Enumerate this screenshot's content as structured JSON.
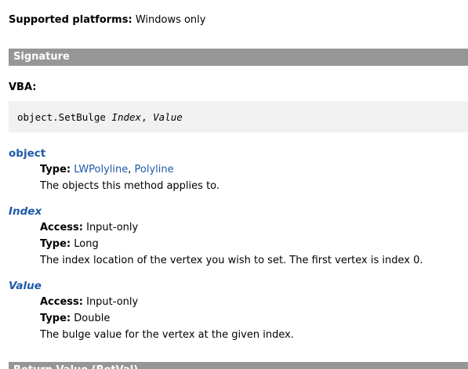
{
  "platforms": {
    "label": "Supported platforms:",
    "value": "Windows only"
  },
  "signature_section": {
    "title": "Signature"
  },
  "vba": {
    "label": "VBA:",
    "code_prefix": "object.SetBulge ",
    "code_arg1": "Index",
    "code_sep": ", ",
    "code_arg2": "Value"
  },
  "params": {
    "object": {
      "name": "object",
      "type_label": "Type:",
      "type_link1": "LWPolyline",
      "type_sep": ", ",
      "type_link2": "Polyline",
      "description": "The objects this method applies to."
    },
    "index": {
      "name": "Index",
      "access_label": "Access:",
      "access_value": "Input-only",
      "type_label": "Type:",
      "type_value": "Long",
      "description": "The index location of the vertex you wish to set. The first vertex is index 0."
    },
    "value": {
      "name": "Value",
      "access_label": "Access:",
      "access_value": "Input-only",
      "type_label": "Type:",
      "type_value": "Double",
      "description": "The bulge value for the vertex at the given index."
    }
  },
  "next_section": {
    "title": "Return Value (RetVal)"
  }
}
